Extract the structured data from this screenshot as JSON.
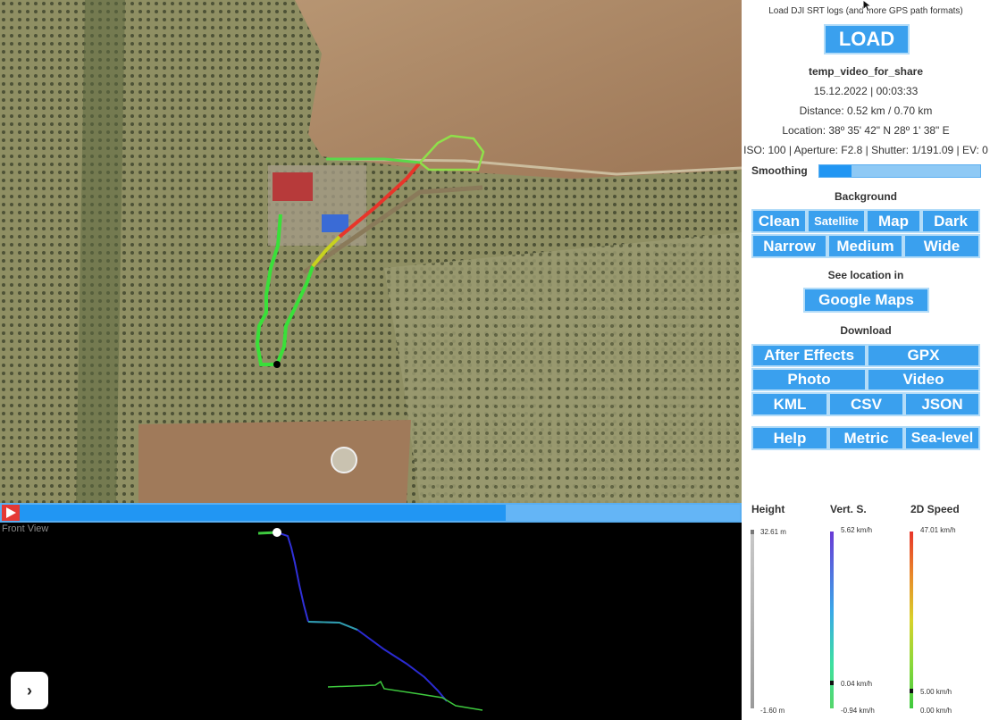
{
  "panel": {
    "load_hint": "Load DJI SRT logs (and more GPS path formats)",
    "load_label": "LOAD",
    "file_name": "temp_video_for_share",
    "datetime": "15.12.2022 | 00:03:33",
    "distance": "Distance: 0.52 km / 0.70 km",
    "location": "Location: 38º 35' 42\" N 28º 1' 38\" E",
    "camera": "ISO: 100 | Aperture: F2.8 | Shutter: 1/191.09 | EV: 0",
    "smoothing_label": "Smoothing",
    "smoothing_level": 0.2,
    "background_title": "Background",
    "background_buttons": [
      "Clean",
      "Satellite",
      "Map",
      "Dark"
    ],
    "width_buttons": [
      "Narrow",
      "Medium",
      "Wide"
    ],
    "see_location_title": "See location in",
    "google_maps_label": "Google Maps",
    "download_title": "Download",
    "download_buttons": [
      "After Effects",
      "GPX",
      "Photo",
      "Video",
      "KML",
      "CSV",
      "JSON"
    ],
    "util_buttons": [
      "Help",
      "Metric",
      "Sea-level"
    ]
  },
  "timeline": {
    "progress": 0.675
  },
  "front_view": {
    "label": "Front View"
  },
  "gauges": {
    "height": {
      "title": "Height",
      "max": "32.61 m",
      "min": "-1.60 m"
    },
    "vertical": {
      "title": "Vert. S.",
      "max": "5.62 km/h",
      "current": "0.04 km/h",
      "min": "-0.94 km/h"
    },
    "speed": {
      "title": "2D Speed",
      "max": "47.01 km/h",
      "current": "5.00 km/h",
      "min": "0.00 km/h"
    }
  },
  "colors": {
    "button_blue": "#3aa0ee",
    "timeline_played": "#2196f3",
    "play_red": "#e53935",
    "track_green": "#3ddc3d",
    "track_red": "#e8352a"
  }
}
